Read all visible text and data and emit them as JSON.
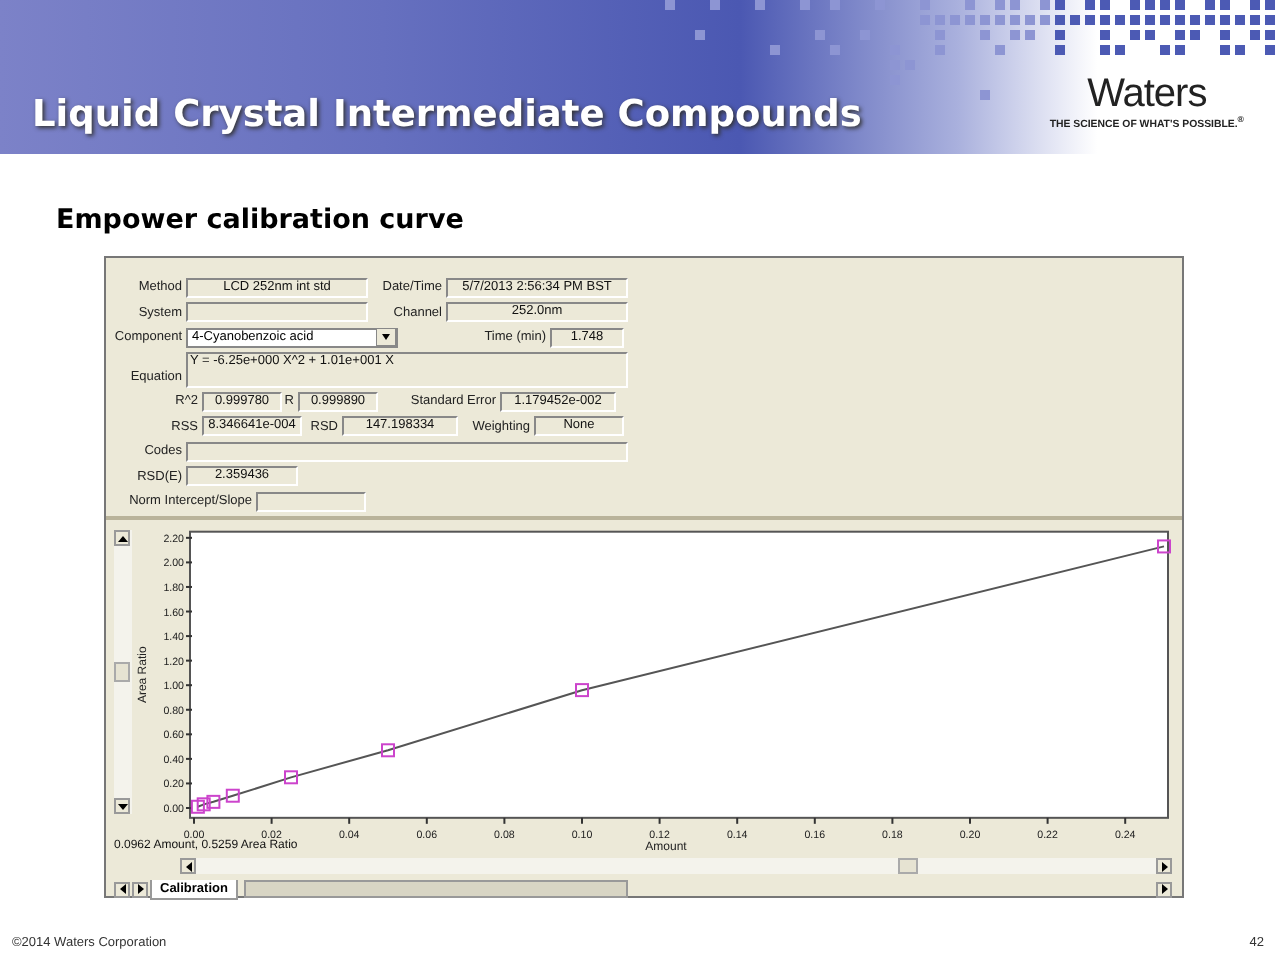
{
  "header": {
    "title": "Liquid Crystal Intermediate Compounds",
    "logo": {
      "name": "Waters",
      "tagline": "THE SCIENCE OF WHAT'S POSSIBLE.$^{®}$"
    }
  },
  "subtitle": "Empower calibration curve",
  "form": {
    "rows": [
      {
        "fields": [
          {
            "label": "Method",
            "kind": "box",
            "value": "LCD 252nm int std"
          },
          {
            "label": "Date/Time",
            "kind": "box",
            "value": "5/7/2013 2:56:34 PM BST"
          }
        ]
      },
      {
        "fields": [
          {
            "label": "System",
            "kind": "box"
          },
          {
            "label": "Channel",
            "kind": "box",
            "value": "252.0nm"
          }
        ]
      },
      {
        "fields": [
          {
            "label": "Component",
            "kind": "dropdown",
            "value": "4-Cyanobenzoic acid"
          },
          {
            "label": "Time (min)",
            "kind": "box",
            "value": "1.748"
          }
        ]
      },
      {
        "fields": [
          {
            "label": "Equation",
            "kind": "memo",
            "value": "Y = -6.25e+000 X^2 + 1.01e+001 X"
          }
        ]
      },
      {
        "fields": [
          {
            "label": "R^2",
            "kind": "box",
            "value": "0.999780"
          },
          {
            "label": "R",
            "kind": "box",
            "value": "0.999890"
          },
          {
            "label": "Standard Error",
            "kind": "box",
            "value": "1.179452e-002"
          }
        ]
      },
      {
        "fields": [
          {
            "label": "RSS",
            "kind": "box",
            "value": "8.346641e-004"
          },
          {
            "label": "RSD",
            "kind": "box",
            "value": "147.198334"
          },
          {
            "label": "Weighting",
            "kind": "box",
            "value": "None"
          }
        ]
      },
      {
        "fields": [
          {
            "label": "Codes",
            "kind": "box"
          }
        ]
      },
      {
        "fields": [
          {
            "label": "RSD(E)",
            "kind": "box",
            "value": "2.359436"
          }
        ]
      },
      {
        "fields": [
          {
            "label": "Norm Intercept/Slope",
            "kind": "box"
          }
        ]
      }
    ]
  },
  "chart": {
    "chart_data": {
      "type": "line",
      "marker": "square",
      "xlabel": "Amount",
      "ylabel": "Area Ratio",
      "x": [
        0.001,
        0.0025,
        0.005,
        0.01,
        0.025,
        0.05,
        0.1,
        0.25
      ],
      "values": [
        0.01,
        0.03,
        0.05,
        0.1,
        0.25,
        0.47,
        0.96,
        2.13
      ],
      "xlim": [
        0,
        0.25
      ],
      "ylim": [
        -0.08,
        2.25
      ],
      "xticks": [
        {
          "value": 0,
          "label": "0.00"
        },
        {
          "value": 0.02,
          "label": "0.02"
        },
        {
          "value": 0.04,
          "label": "0.04"
        },
        {
          "value": 0.06,
          "label": "0.06"
        },
        {
          "value": 0.08,
          "label": "0.08"
        },
        {
          "value": 0.1,
          "label": "0.10"
        },
        {
          "value": 0.12,
          "label": "0.12"
        },
        {
          "value": 0.14,
          "label": "0.14"
        },
        {
          "value": 0.16,
          "label": "0.16"
        },
        {
          "value": 0.18,
          "label": "0.18"
        },
        {
          "value": 0.2,
          "label": "0.20"
        },
        {
          "value": 0.22,
          "label": "0.22"
        },
        {
          "value": 0.24,
          "label": "0.24"
        }
      ],
      "yticks": [
        {
          "value": 0,
          "label": "0.00"
        },
        {
          "value": 0.2,
          "label": "0.20"
        },
        {
          "value": 0.4,
          "label": "0.40"
        },
        {
          "value": 0.6,
          "label": "0.60"
        },
        {
          "value": 0.8,
          "label": "0.80"
        },
        {
          "value": 1,
          "label": "1.00"
        },
        {
          "value": 1.2,
          "label": "1.20"
        },
        {
          "value": 1.4,
          "label": "1.40"
        },
        {
          "value": 1.6,
          "label": "1.60"
        },
        {
          "value": 1.8,
          "label": "1.80"
        },
        {
          "value": 2,
          "label": "2.00"
        },
        {
          "value": 2.2,
          "label": "2.20"
        }
      ]
    },
    "status_text": "0.0962 Amount, 0.5259 Area Ratio",
    "tabs": [
      {
        "label": "Calibration",
        "selected": true
      }
    ]
  },
  "footer": {
    "copyright": "©2014 Waters Corporation",
    "page_number": "42"
  }
}
